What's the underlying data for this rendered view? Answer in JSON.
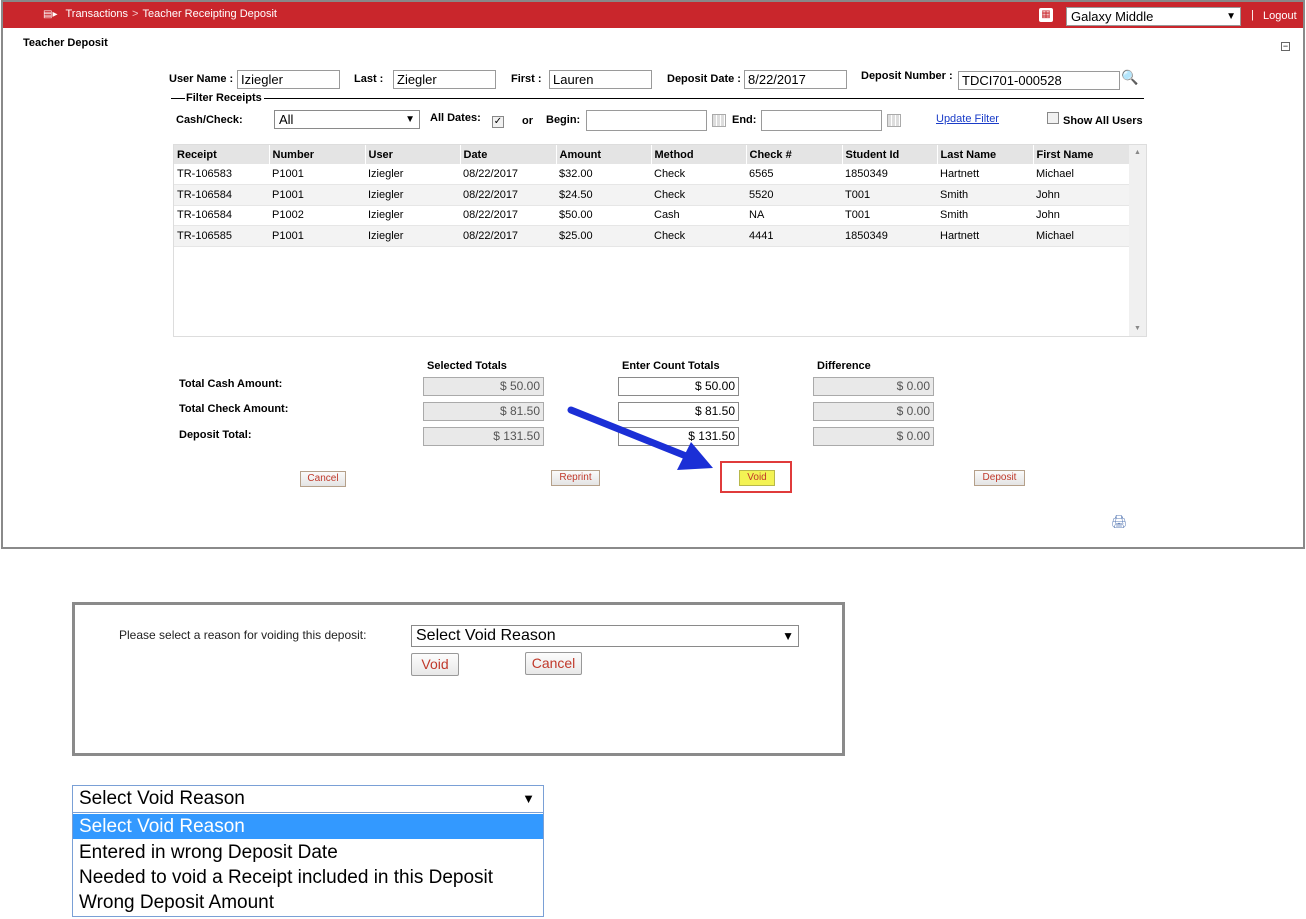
{
  "breadcrumb": {
    "section": "Transactions",
    "separator": ">",
    "page": "Teacher Receipting Deposit"
  },
  "header": {
    "school": "Galaxy Middle",
    "pipe": "|",
    "logout": "Logout"
  },
  "page_title": "Teacher Deposit",
  "collapse_glyph": "−",
  "form": {
    "user_name_label": "User Name :",
    "user_name": "Iziegler",
    "last_label": "Last :",
    "last": "Ziegler",
    "first_label": "First :",
    "first": "Lauren",
    "deposit_date_label": "Deposit Date :",
    "deposit_date": "8/22/2017",
    "deposit_number_label": "Deposit Number :",
    "deposit_number": "TDCI701-000528"
  },
  "filter": {
    "legend": "Filter Receipts",
    "cash_check_label": "Cash/Check:",
    "cash_check_value": "All",
    "all_dates_label": "All Dates:",
    "all_dates_checked": true,
    "or_label": "or",
    "begin_label": "Begin:",
    "end_label": "End:",
    "update_filter": "Update Filter",
    "show_all_users": "Show All Users"
  },
  "table": {
    "columns": [
      "Receipt",
      "Number",
      "User",
      "Date",
      "Amount",
      "Method",
      "Check #",
      "Student Id",
      "Last Name",
      "First Name"
    ],
    "rows": [
      [
        "TR-106583",
        "P1001",
        "Iziegler",
        "08/22/2017",
        "$32.00",
        "Check",
        "6565",
        "1850349",
        "Hartnett",
        "Michael"
      ],
      [
        "TR-106584",
        "P1001",
        "Iziegler",
        "08/22/2017",
        "$24.50",
        "Check",
        "5520",
        "T001",
        "Smith",
        "John"
      ],
      [
        "TR-106584",
        "P1002",
        "Iziegler",
        "08/22/2017",
        "$50.00",
        "Cash",
        "NA",
        "T001",
        "Smith",
        "John"
      ],
      [
        "TR-106585",
        "P1001",
        "Iziegler",
        "08/22/2017",
        "$25.00",
        "Check",
        "4441",
        "1850349",
        "Hartnett",
        "Michael"
      ]
    ]
  },
  "totals": {
    "selected_header": "Selected Totals",
    "enter_header": "Enter Count Totals",
    "difference_header": "Difference",
    "cash_label": "Total Cash Amount:",
    "check_label": "Total Check Amount:",
    "deposit_label": "Deposit Total:",
    "selected": {
      "cash": "$ 50.00",
      "check": "$ 81.50",
      "total": "$ 131.50"
    },
    "entered": {
      "cash": "$ 50.00",
      "check": "$ 81.50",
      "total": "$ 131.50"
    },
    "difference": {
      "cash": "$ 0.00",
      "check": "$ 0.00",
      "total": "$ 0.00"
    }
  },
  "buttons": {
    "cancel": "Cancel",
    "reprint": "Reprint",
    "void": "Void",
    "deposit": "Deposit"
  },
  "dialog": {
    "prompt": "Please select a reason for voiding this deposit:",
    "select_value": "Select Void Reason",
    "void": "Void",
    "cancel": "Cancel"
  },
  "dropdown": {
    "selected": "Select Void Reason",
    "options": [
      "Select Void Reason",
      "Entered in wrong Deposit Date",
      "Needed to void a Receipt included in this Deposit",
      "Wrong Deposit Amount"
    ],
    "highlighted_index": 0
  },
  "colors": {
    "header_red": "#c9262c",
    "highlight_yellow": "#f3f354",
    "arrow_blue": "#1b2fd6",
    "option_blue": "#3399ff"
  }
}
